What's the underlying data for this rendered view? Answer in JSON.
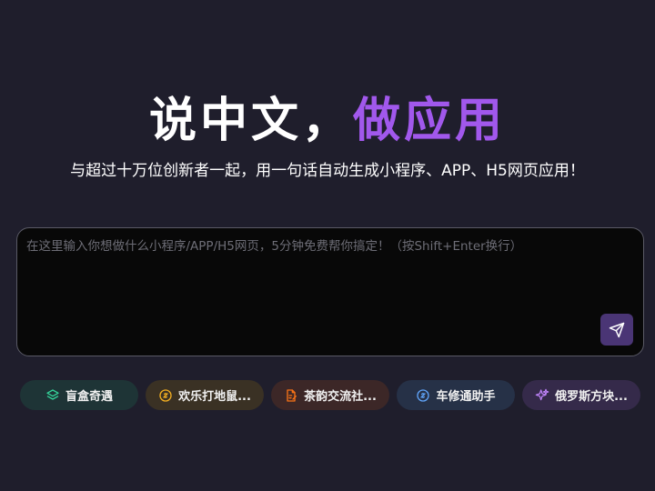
{
  "hero": {
    "title_part1": "说中文，",
    "title_part2": "做应用",
    "subtitle": "与超过十万位创新者一起，用一句话自动生成小程序、APP、H5网页应用！"
  },
  "prompt": {
    "placeholder": "在这里输入你想做什么小程序/APP/H5网页，5分钟免费帮你搞定！（按Shift+Enter换行）",
    "value": ""
  },
  "chips": [
    {
      "label": "盲盒奇遇",
      "icon": "layers-icon",
      "color": "#34d399"
    },
    {
      "label": "欢乐打地鼠...",
      "icon": "link-icon",
      "color": "#f5b021"
    },
    {
      "label": "茶韵交流社...",
      "icon": "document-edit-icon",
      "color": "#f97316"
    },
    {
      "label": "车修通助手",
      "icon": "link-icon",
      "color": "#60a5fa"
    },
    {
      "label": "俄罗斯方块...",
      "icon": "sparkles-icon",
      "color": "#c084fc"
    }
  ],
  "colors": {
    "background": "#1f1e2c",
    "accent": "#a158ec",
    "send_button": "#4a3575"
  }
}
